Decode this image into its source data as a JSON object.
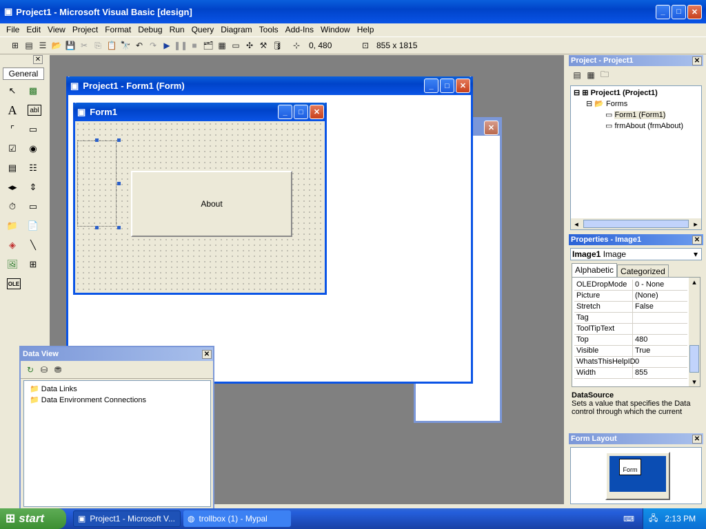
{
  "window": {
    "title": "Project1 - Microsoft Visual Basic [design]"
  },
  "menu": [
    "File",
    "Edit",
    "View",
    "Project",
    "Format",
    "Debug",
    "Run",
    "Query",
    "Diagram",
    "Tools",
    "Add-Ins",
    "Window",
    "Help"
  ],
  "toolbar": {
    "position": "0, 480",
    "size": "855 x 1815"
  },
  "toolbox": {
    "tab_label": "General"
  },
  "form_designer": {
    "title": "Project1 - Form1 (Form)"
  },
  "form1": {
    "title": "Form1",
    "button_label": "About"
  },
  "project_explorer": {
    "title": "Project - Project1",
    "root": "Project1 (Project1)",
    "folder": "Forms",
    "items": [
      "Form1 (Form1)",
      "frmAbout (frmAbout)"
    ]
  },
  "properties": {
    "title": "Properties - Image1",
    "object_name": "Image1",
    "object_type": "Image",
    "tabs": [
      "Alphabetic",
      "Categorized"
    ],
    "rows": [
      {
        "name": "OLEDropMode",
        "value": "0 - None"
      },
      {
        "name": "Picture",
        "value": "(None)"
      },
      {
        "name": "Stretch",
        "value": "False"
      },
      {
        "name": "Tag",
        "value": ""
      },
      {
        "name": "ToolTipText",
        "value": ""
      },
      {
        "name": "Top",
        "value": "480"
      },
      {
        "name": "Visible",
        "value": "True"
      },
      {
        "name": "WhatsThisHelpID",
        "value": "0"
      },
      {
        "name": "Width",
        "value": "855"
      }
    ],
    "desc_title": "DataSource",
    "desc_text": "Sets a value that specifies the Data control through which the current"
  },
  "form_layout": {
    "title": "Form Layout",
    "preview_label": "Form"
  },
  "data_view": {
    "title": "Data View",
    "items": [
      "Data Links",
      "Data Environment Connections"
    ]
  },
  "taskbar": {
    "start": "start",
    "tasks": [
      "Project1 - Microsoft V...",
      "trollbox (1) - Mypal"
    ],
    "clock": "2:13 PM"
  }
}
